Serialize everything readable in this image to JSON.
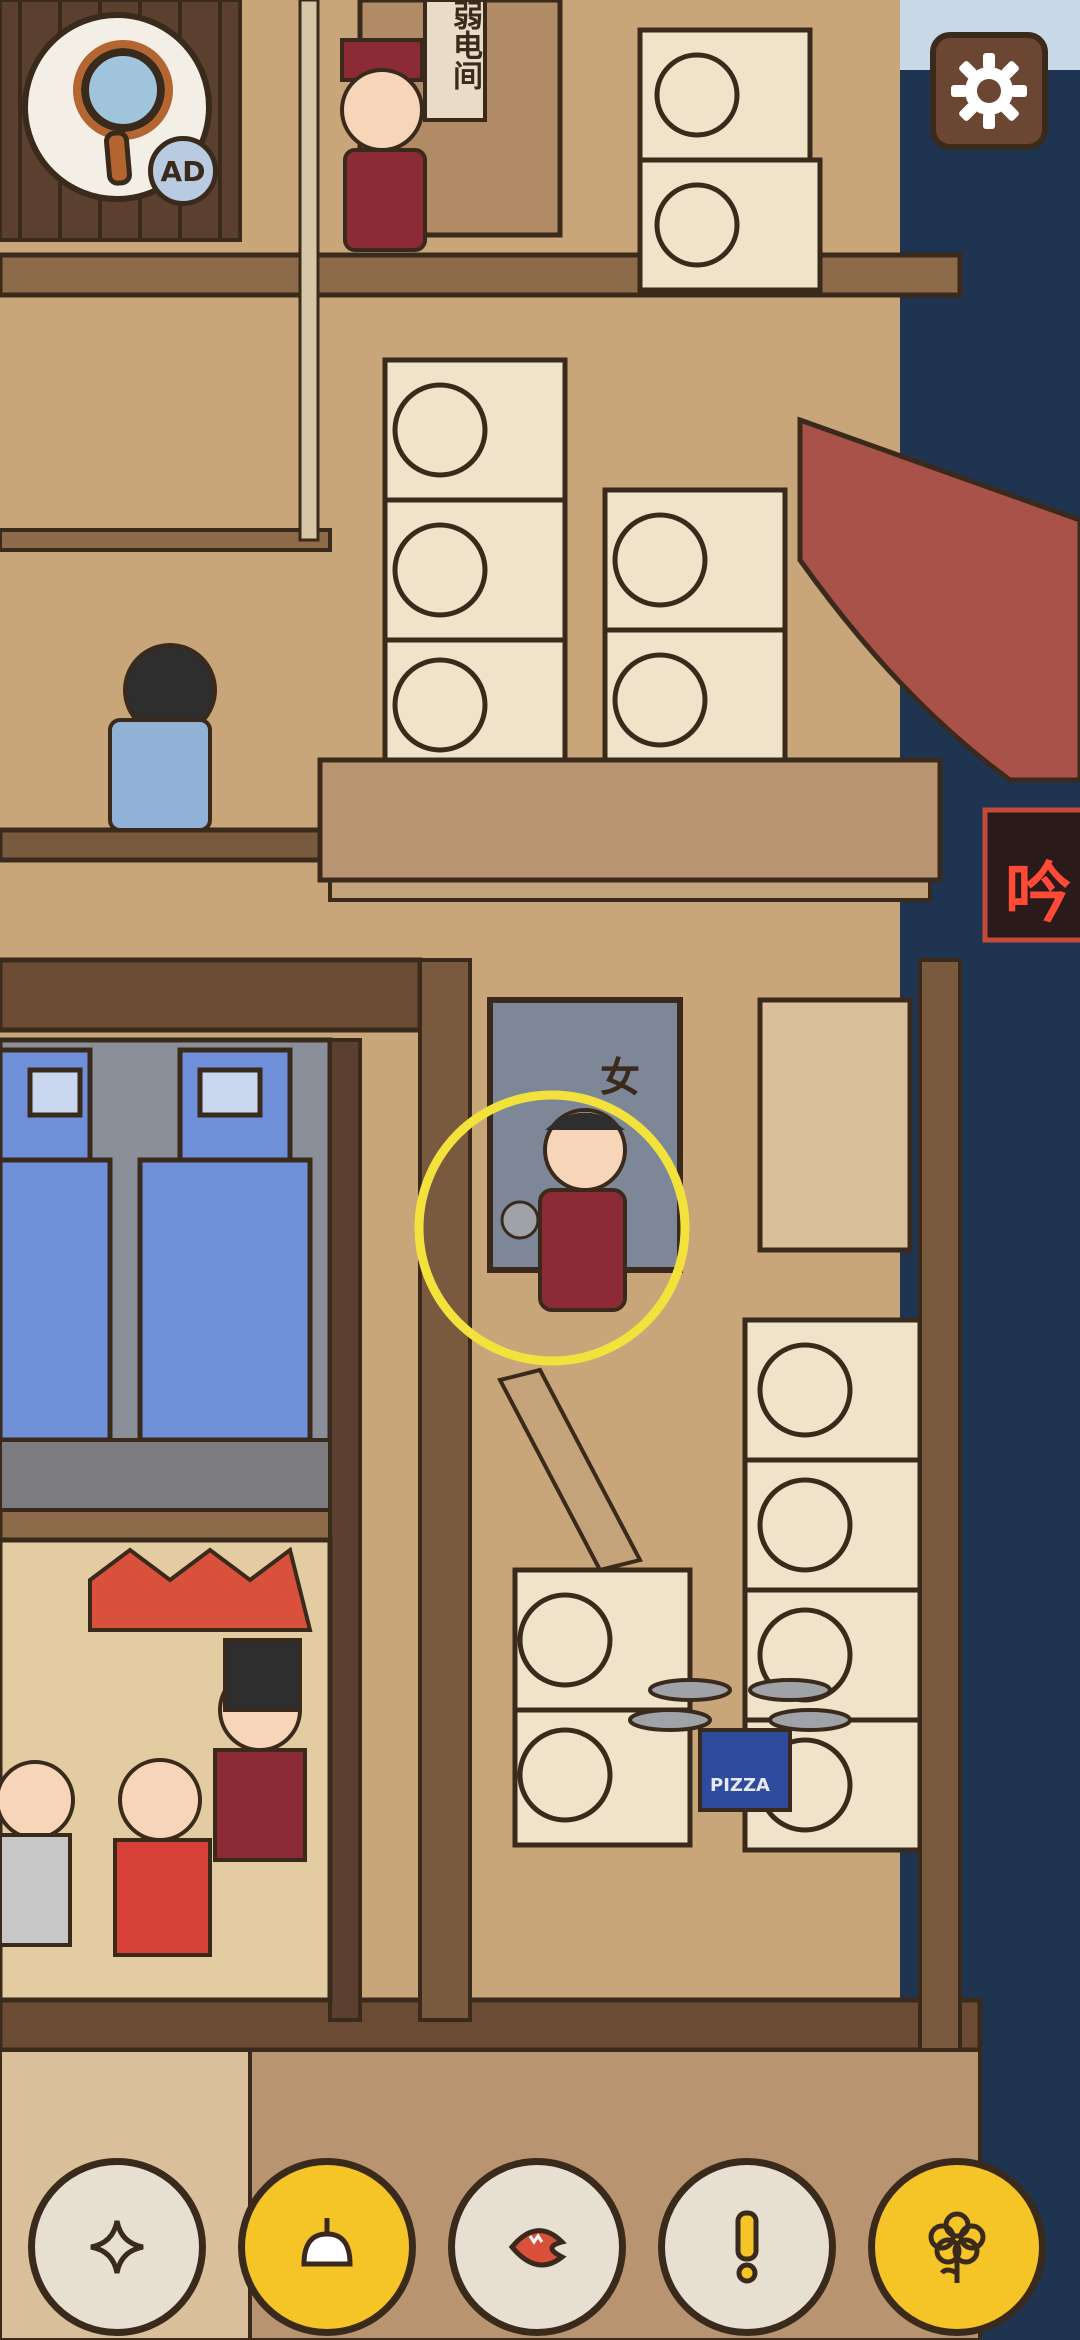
{
  "game": {
    "hud": {
      "hint_button": {
        "icon": "magnifier-icon",
        "badge_label": "AD"
      },
      "settings_button": {
        "icon": "gear-icon"
      }
    },
    "scene_signs": {
      "top_door_sign": "弱电间",
      "restroom_sign": "女",
      "neon_sign": "吟",
      "drone_box_label": "PIZZA"
    },
    "toolbar": [
      {
        "id": "sparkle",
        "icon": "sparkle-icon",
        "color": "#e6dfd2"
      },
      {
        "id": "lamp",
        "icon": "lamp-icon",
        "color": "#f5c528"
      },
      {
        "id": "mouth",
        "icon": "open-mouth-icon",
        "color": "#e6dfd2"
      },
      {
        "id": "exclaim",
        "icon": "exclamation-icon",
        "color": "#e6dfd2"
      },
      {
        "id": "flower",
        "icon": "flower-icon",
        "color": "#f5c528"
      }
    ],
    "highlight": {
      "color": "#f3e23c",
      "target": "girl-in-red-robe"
    },
    "colors": {
      "wood": "#c9a57a",
      "dark_wood": "#5b4030",
      "outline": "#3a2a1c",
      "night_sky": "#1e3450",
      "server_blue": "#6f8fd8",
      "ac_unit": "#efe4c9",
      "roof_red": "#a8524a"
    }
  }
}
